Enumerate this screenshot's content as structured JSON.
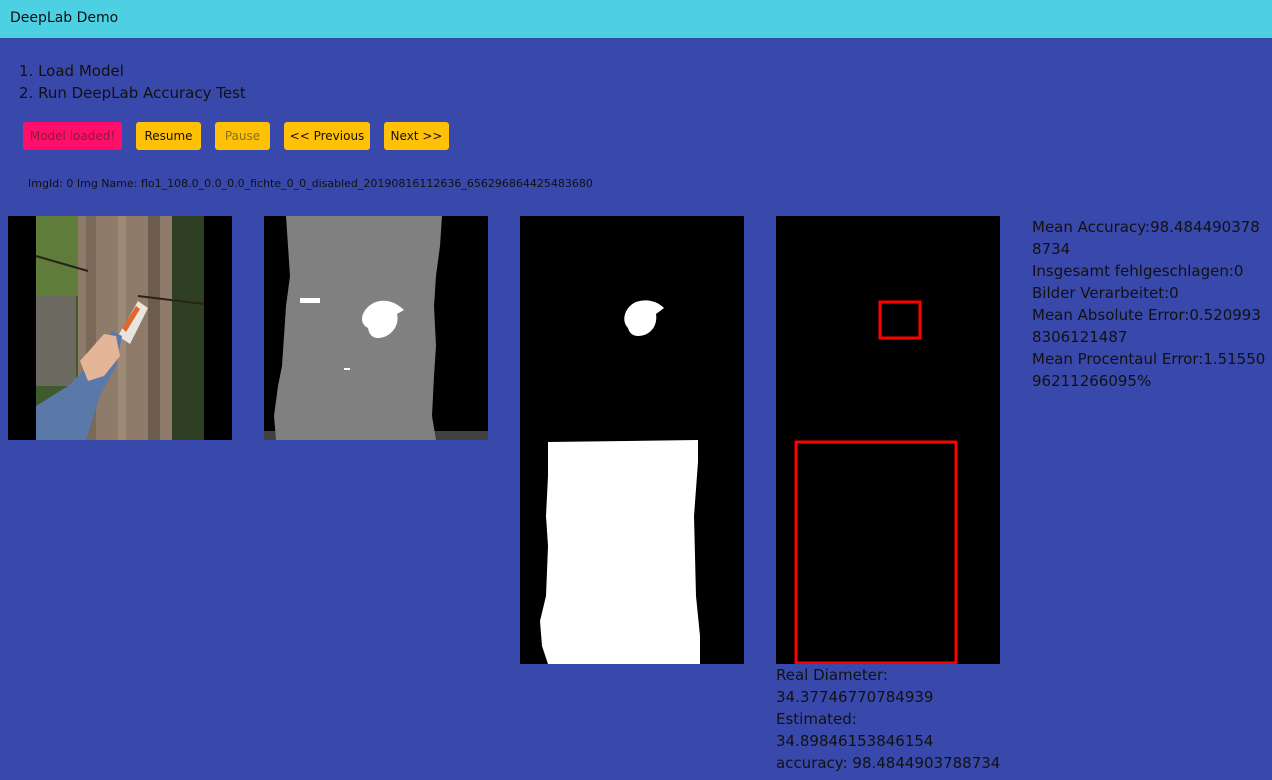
{
  "app": {
    "title": "DeepLab Demo"
  },
  "steps": [
    "1. Load Model",
    "2. Run DeepLab Accuracy Test"
  ],
  "buttons": {
    "model": "Model loaded!",
    "resume": "Resume",
    "pause": "Pause",
    "previous": "<< Previous",
    "next": "Next >>"
  },
  "image_info": "ImgId: 0 Img Name: flo1_108.0_0.0_0.0_fichte_0_0_disabled_20190816112636_656296864425483680",
  "stats": {
    "mean_accuracy": "Mean Accuracy:98.4844903788734",
    "failed": "Insgesamt fehlgeschlagen:0",
    "processed": "Bilder Verarbeitet:0",
    "mean_absolute_error": "Mean Absolute Error:0.5209938306121487",
    "mean_percent_error": "Mean Procentaul Error:1.5155096211266095%"
  },
  "result": {
    "real_label": "Real Diameter:",
    "real_value": "34.37746770784939",
    "estimated_label": "Estimated:",
    "estimated_value": "34.89846153846154",
    "accuracy": "accuracy: 98.4844903788734"
  },
  "colors": {
    "background": "#3949ab",
    "topbar": "#4dd0e1",
    "button": "#ffc107",
    "loaded_button": "#ff0f6a",
    "box": "#ff0000"
  }
}
